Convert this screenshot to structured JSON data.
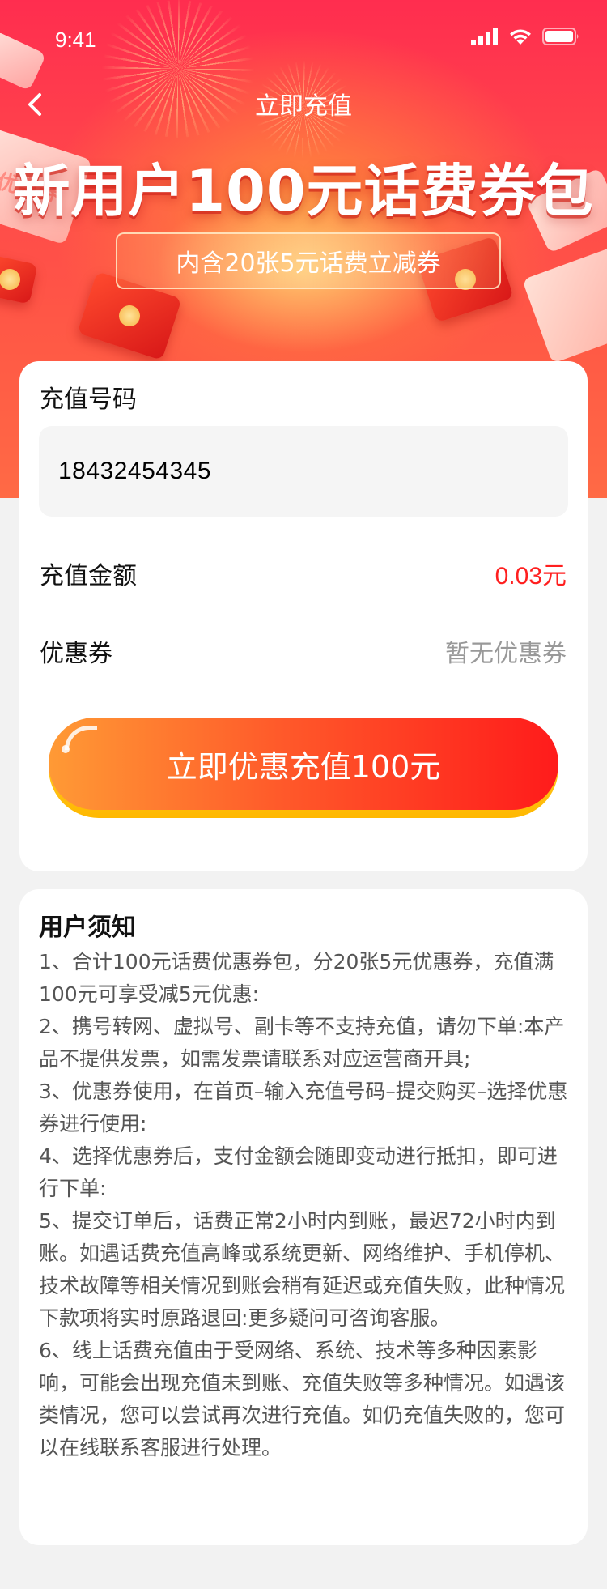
{
  "status_bar": {
    "time": "9:41"
  },
  "nav": {
    "title": "立即充值"
  },
  "hero": {
    "title": "新用户100元话费券包",
    "subtitle": "内含20张5元话费立减券",
    "ticket_text": "优惠券"
  },
  "form": {
    "phone_label": "充值号码",
    "phone_value": "18432454345",
    "amount_label": "充值金额",
    "amount_value": "0.03元",
    "coupon_label": "优惠券",
    "coupon_value": "暂无优惠券",
    "cta_label": "立即优惠充值100元"
  },
  "notice": {
    "title": "用户须知",
    "items": [
      "1、合计100元话费优惠券包，分20张5元优惠券，充值满100元可享受减5元优惠:",
      "2、携号转网、虚拟号、副卡等不支持充值，请勿下单:本产品不提供发票，如需发票请联系对应运营商开具;",
      "3、优惠券使用，在首页–输入充值号码–提交购买–选择优惠券进行使用:",
      "4、选择优惠券后，支付金额会随即变动进行抵扣，即可进行下单:",
      "5、提交订单后，话费正常2小时内到账，最迟72小时内到账。如遇话费充值高峰或系统更新、网络维护、手机停机、技术故障等相关情况到账会稍有延迟或充值失败，此种情况下款项将实时原路退回:更多疑问可咨询客服。",
      "6、线上话费充值由于受网络、系统、技术等多种因素影响，可能会出现充值未到账、充值失败等多种情况。如遇该类情况，您可以尝试再次进行充值。如仍充值失败的，您可以在线联系客服进行处理。"
    ]
  },
  "colors": {
    "hero_red": "#ff2d4f",
    "accent_red": "#ff1f1f",
    "cta_orange": "#ff9a35",
    "cta_yellow": "#ffd23a"
  },
  "icons": [
    "signal-icon",
    "wifi-icon",
    "battery-icon",
    "back-icon"
  ]
}
